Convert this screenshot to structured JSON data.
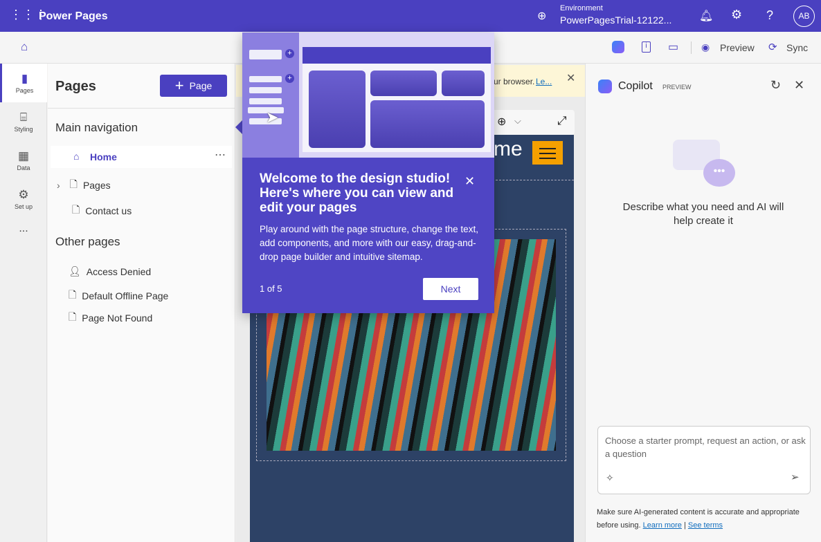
{
  "topbar": {
    "app_title": "Power Pages",
    "env_label": "Environment",
    "env_name": "PowerPagesTrial-12122...",
    "avatar": "AB"
  },
  "toolbar": {
    "preview": "Preview",
    "sync": "Sync"
  },
  "rail": [
    {
      "label": "Pages"
    },
    {
      "label": "Styling"
    },
    {
      "label": "Data"
    },
    {
      "label": "Set up"
    },
    {
      "label": "..."
    }
  ],
  "panel": {
    "title": "Pages",
    "add_page": "Page",
    "main_nav": "Main navigation",
    "main_items": [
      "Home",
      "Pages",
      "Contact us"
    ],
    "other_pages": "Other pages",
    "other_items": [
      "Access Denied",
      "Default Offline Page",
      "Page Not Found"
    ]
  },
  "banner": {
    "text": "ur browser.",
    "link": "Le..."
  },
  "site": {
    "title_fragment": "me"
  },
  "popup": {
    "title": "Welcome to the design studio! Here's where you can view and edit your pages",
    "body": "Play around with the page structure, change the text, add components, and more with our easy, drag-and-drop page builder and intuitive sitemap.",
    "step": "1 of 5",
    "next": "Next"
  },
  "copilot": {
    "title": "Copilot",
    "badge": "PREVIEW",
    "prompt": "Describe what you need and AI will help create it",
    "placeholder": "Choose a starter prompt, request an action, or ask a question",
    "disclaimer": "Make sure AI-generated content is accurate and appropriate before using.",
    "learn_more": "Learn more",
    "separator": "|",
    "see_terms": "See terms"
  }
}
